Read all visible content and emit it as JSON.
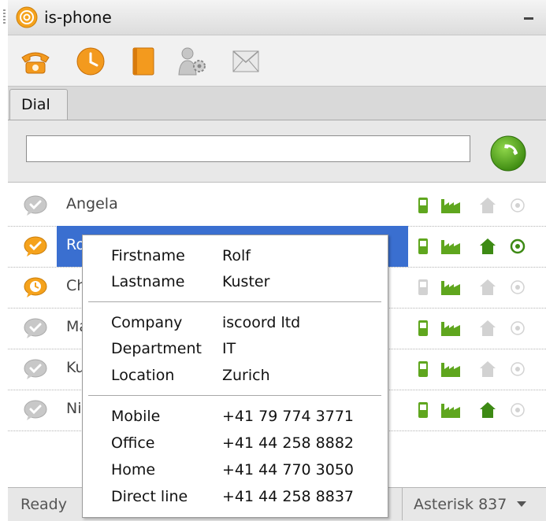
{
  "app": {
    "title": "is-phone",
    "minimize_icon": "minimize-icon",
    "logo_icon": "at-sign-logo-icon"
  },
  "toolbar": {
    "buttons": [
      {
        "name": "phone-icon"
      },
      {
        "name": "clock-history-icon"
      },
      {
        "name": "addressbook-icon"
      },
      {
        "name": "user-settings-icon"
      },
      {
        "name": "envelope-icon"
      }
    ]
  },
  "tabs": [
    {
      "label": "Dial",
      "active": true
    }
  ],
  "dial": {
    "value": "",
    "placeholder": ""
  },
  "contacts": [
    {
      "name": "Angela",
      "avatar": "gray",
      "mobile": "on",
      "office": "on",
      "home": "off",
      "direct": "off"
    },
    {
      "name": "Ro",
      "avatar": "orange",
      "mobile": "on",
      "office": "on",
      "home": "on",
      "direct": "on",
      "selected": true
    },
    {
      "name": "Ch",
      "avatar": "orange-clock",
      "mobile": "off",
      "office": "on",
      "home": "off",
      "direct": "off"
    },
    {
      "name": "Ma",
      "avatar": "gray",
      "mobile": "on",
      "office": "on",
      "home": "off",
      "direct": "off"
    },
    {
      "name": "Ku",
      "avatar": "gray",
      "mobile": "on",
      "office": "on",
      "home": "off",
      "direct": "off"
    },
    {
      "name": "Ni",
      "avatar": "gray",
      "mobile": "on",
      "office": "on",
      "home": "on",
      "direct": "off"
    }
  ],
  "popup": {
    "firstname_label": "Firstname",
    "firstname": "Rolf",
    "lastname_label": "Lastname",
    "lastname": "Kuster",
    "company_label": "Company",
    "company": "iscoord ltd",
    "department_label": "Department",
    "department": "IT",
    "location_label": "Location",
    "location": "Zurich",
    "mobile_label": "Mobile",
    "mobile": "+41 79 774 3771",
    "office_label": "Office",
    "office": "+41 44 258 8882",
    "home_label": "Home",
    "home": "+41 44 770 3050",
    "direct_label": "Direct line",
    "direct": "+41 44 258 8837"
  },
  "status": {
    "text": "Ready",
    "server": "Asterisk 837"
  },
  "colors": {
    "orange": "#f5a21c",
    "green": "#5fa61e",
    "selection": "#3a6fd0",
    "gray": "#c8c8c8"
  }
}
